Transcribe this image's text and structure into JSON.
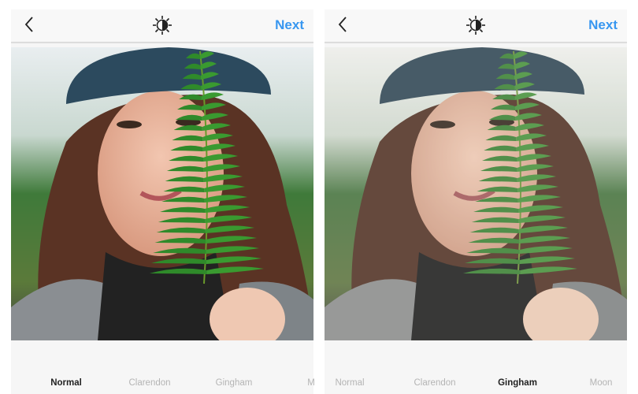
{
  "colors": {
    "accent": "#3897f0",
    "active_label": "#222222",
    "inactive_label": "#b4b4b4"
  },
  "panels": [
    {
      "next_label": "Next",
      "icons": {
        "back": "chevron-left-icon",
        "lux": "lux-brightness-icon"
      },
      "filters": [
        {
          "label": "Normal",
          "active": true
        },
        {
          "label": "Clarendon",
          "active": false
        },
        {
          "label": "Gingham",
          "active": false
        },
        {
          "label": "M",
          "active": false
        }
      ]
    },
    {
      "next_label": "Next",
      "icons": {
        "back": "chevron-left-icon",
        "lux": "lux-brightness-icon"
      },
      "filters": [
        {
          "label": "Normal",
          "active": false
        },
        {
          "label": "Clarendon",
          "active": false
        },
        {
          "label": "Gingham",
          "active": true
        },
        {
          "label": "Moon",
          "active": false
        }
      ]
    }
  ]
}
